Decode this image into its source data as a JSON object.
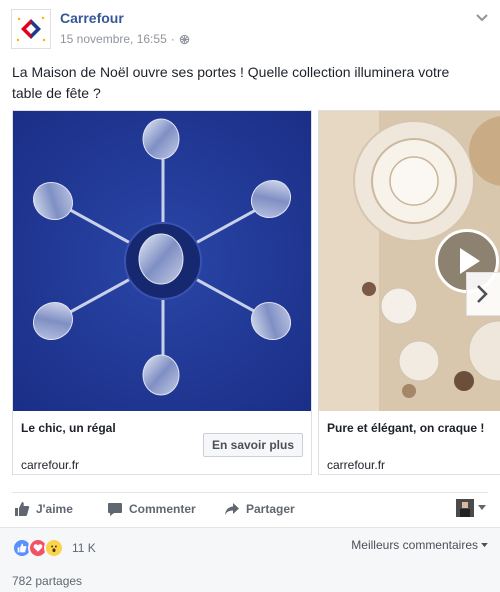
{
  "post": {
    "page_name": "Carrefour",
    "timestamp": "15 novembre, 16:55",
    "separator": "·",
    "privacy_icon": "globe-icon",
    "text": "La Maison de Noël ouvre ses portes ! Quelle collection illuminera votre table de fête ?"
  },
  "carousel": {
    "cards": [
      {
        "title": "Le chic, un régal",
        "cta": "En savoir plus",
        "domain": "carrefour.fr"
      },
      {
        "title": "Pure et élégant, on craque !",
        "domain": "carrefour.fr"
      }
    ]
  },
  "actions": {
    "like": "J'aime",
    "comment": "Commenter",
    "share": "Partager"
  },
  "stats": {
    "reactions_count": "11 K",
    "sort_label": "Meilleurs commentaires",
    "shares": "782 partages"
  },
  "colors": {
    "link": "#365899",
    "text": "#1d2129",
    "muted": "#90949c",
    "carrefour_blue": "#1e3a8a",
    "carrefour_red": "#e3001b"
  }
}
